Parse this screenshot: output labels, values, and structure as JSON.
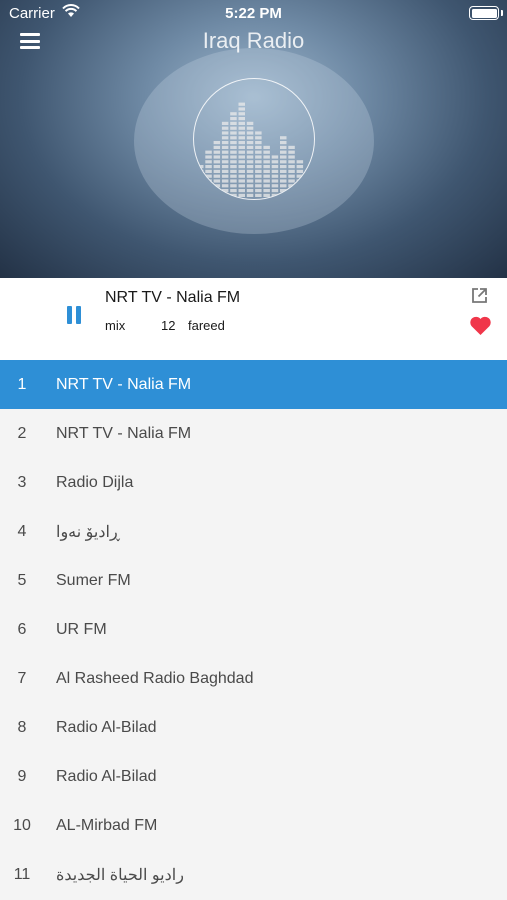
{
  "status_bar": {
    "carrier": "Carrier",
    "time": "5:22 PM"
  },
  "header": {
    "title": "Iraq Radio"
  },
  "now_playing": {
    "title": "NRT TV - Nalia FM",
    "genre": "mix",
    "count": "12",
    "author": "fareed",
    "accent_color": "#2e8fd6",
    "heart_color": "#f0364a"
  },
  "stations": [
    {
      "num": "1",
      "name": "NRT TV - Nalia FM",
      "active": true
    },
    {
      "num": "2",
      "name": "NRT TV - Nalia FM"
    },
    {
      "num": "3",
      "name": "Radio Dijla"
    },
    {
      "num": "4",
      "name": "ڕادیۆ نەوا"
    },
    {
      "num": "5",
      "name": "Sumer FM"
    },
    {
      "num": "6",
      "name": "UR FM"
    },
    {
      "num": "7",
      "name": "Al Rasheed Radio Baghdad"
    },
    {
      "num": "8",
      "name": "Radio Al-Bilad"
    },
    {
      "num": "9",
      "name": "Radio Al-Bilad"
    },
    {
      "num": "10",
      "name": "AL-Mirbad FM"
    },
    {
      "num": "11",
      "name": "راديو الحياة الجديدة"
    }
  ],
  "equalizer_levels": [
    0.3,
    0.45,
    0.55,
    0.7,
    0.82,
    0.9,
    0.72,
    0.62,
    0.5,
    0.42,
    0.58,
    0.48,
    0.35
  ]
}
